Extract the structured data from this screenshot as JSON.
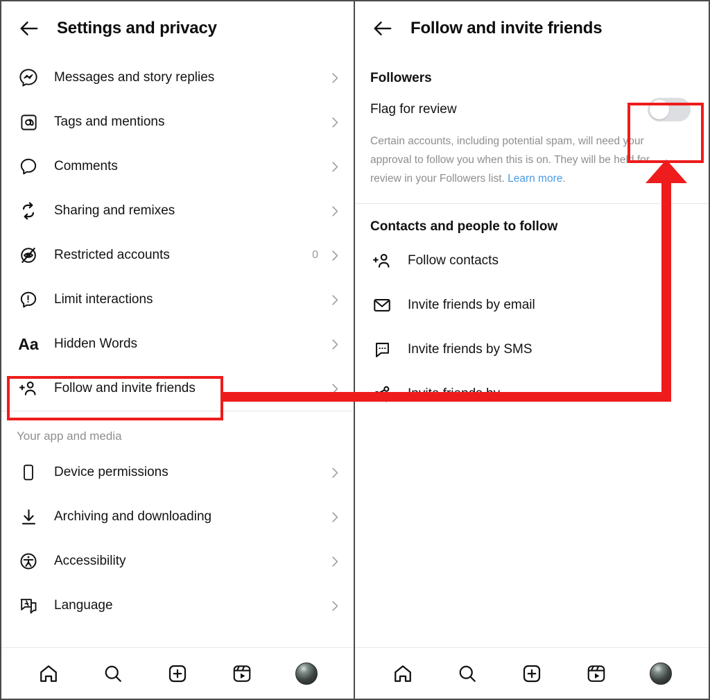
{
  "left_panel": {
    "header": {
      "back_icon": "arrow-left-icon",
      "title": "Settings and privacy"
    },
    "items": [
      {
        "icon": "messenger-icon",
        "label": "Messages and story replies",
        "count": "",
        "chevron": "chevron-right-icon"
      },
      {
        "icon": "at-mention-icon",
        "label": "Tags and mentions",
        "count": "",
        "chevron": "chevron-right-icon"
      },
      {
        "icon": "comment-bubble-icon",
        "label": "Comments",
        "count": "",
        "chevron": "chevron-right-icon"
      },
      {
        "icon": "remix-loop-icon",
        "label": "Sharing and remixes",
        "count": "",
        "chevron": "chevron-right-icon"
      },
      {
        "icon": "restricted-eye-icon",
        "label": "Restricted accounts",
        "count": "0",
        "chevron": "chevron-right-icon"
      },
      {
        "icon": "exclamation-bubble-icon",
        "label": "Limit interactions",
        "count": "",
        "chevron": "chevron-right-icon"
      },
      {
        "icon": "aa-text-icon",
        "label": "Hidden Words",
        "count": "",
        "chevron": "chevron-right-icon"
      },
      {
        "icon": "add-person-icon",
        "label": "Follow and invite friends",
        "count": "",
        "chevron": "chevron-right-icon"
      }
    ],
    "section_title": "Your app and media",
    "items2": [
      {
        "icon": "phone-icon",
        "label": "Device permissions",
        "count": "",
        "chevron": "chevron-right-icon"
      },
      {
        "icon": "download-icon",
        "label": "Archiving and downloading",
        "count": "",
        "chevron": "chevron-right-icon"
      },
      {
        "icon": "accessibility-icon",
        "label": "Accessibility",
        "count": "",
        "chevron": "chevron-right-icon"
      },
      {
        "icon": "language-translate-icon",
        "label": "Language",
        "count": "",
        "chevron": "chevron-right-icon"
      }
    ]
  },
  "right_panel": {
    "header": {
      "back_icon": "arrow-left-icon",
      "title": "Follow and invite friends"
    },
    "followers_group": "Followers",
    "flag_row": {
      "label": "Flag for review",
      "toggle_state": "off"
    },
    "description_before": "Certain accounts, including potential spam, will need your approval to follow you when this is on. They will be held for review in your Followers list. ",
    "description_link": "Learn more",
    "description_after": ".",
    "contacts_group": "Contacts and people to follow",
    "items": [
      {
        "icon": "add-person-icon",
        "label": "Follow contacts"
      },
      {
        "icon": "envelope-icon",
        "label": "Invite friends by email"
      },
      {
        "icon": "sms-bubble-icon",
        "label": "Invite friends by SMS"
      },
      {
        "icon": "share-nodes-icon",
        "label": "Invite friends by…"
      }
    ]
  },
  "bottom_nav": {
    "items": [
      {
        "icon": "home-icon",
        "name": "nav-home"
      },
      {
        "icon": "search-icon",
        "name": "nav-search"
      },
      {
        "icon": "plus-square-icon",
        "name": "nav-create"
      },
      {
        "icon": "reels-icon",
        "name": "nav-reels"
      },
      {
        "icon": "avatar-icon",
        "name": "nav-profile"
      }
    ]
  },
  "annotations": {
    "highlight_color": "#ee1c1c",
    "boxes": [
      "follow-and-invite-friends-row",
      "flag-for-review-toggle"
    ],
    "arrow": "from-follow-and-invite-friends-to-flag-for-review-toggle"
  }
}
